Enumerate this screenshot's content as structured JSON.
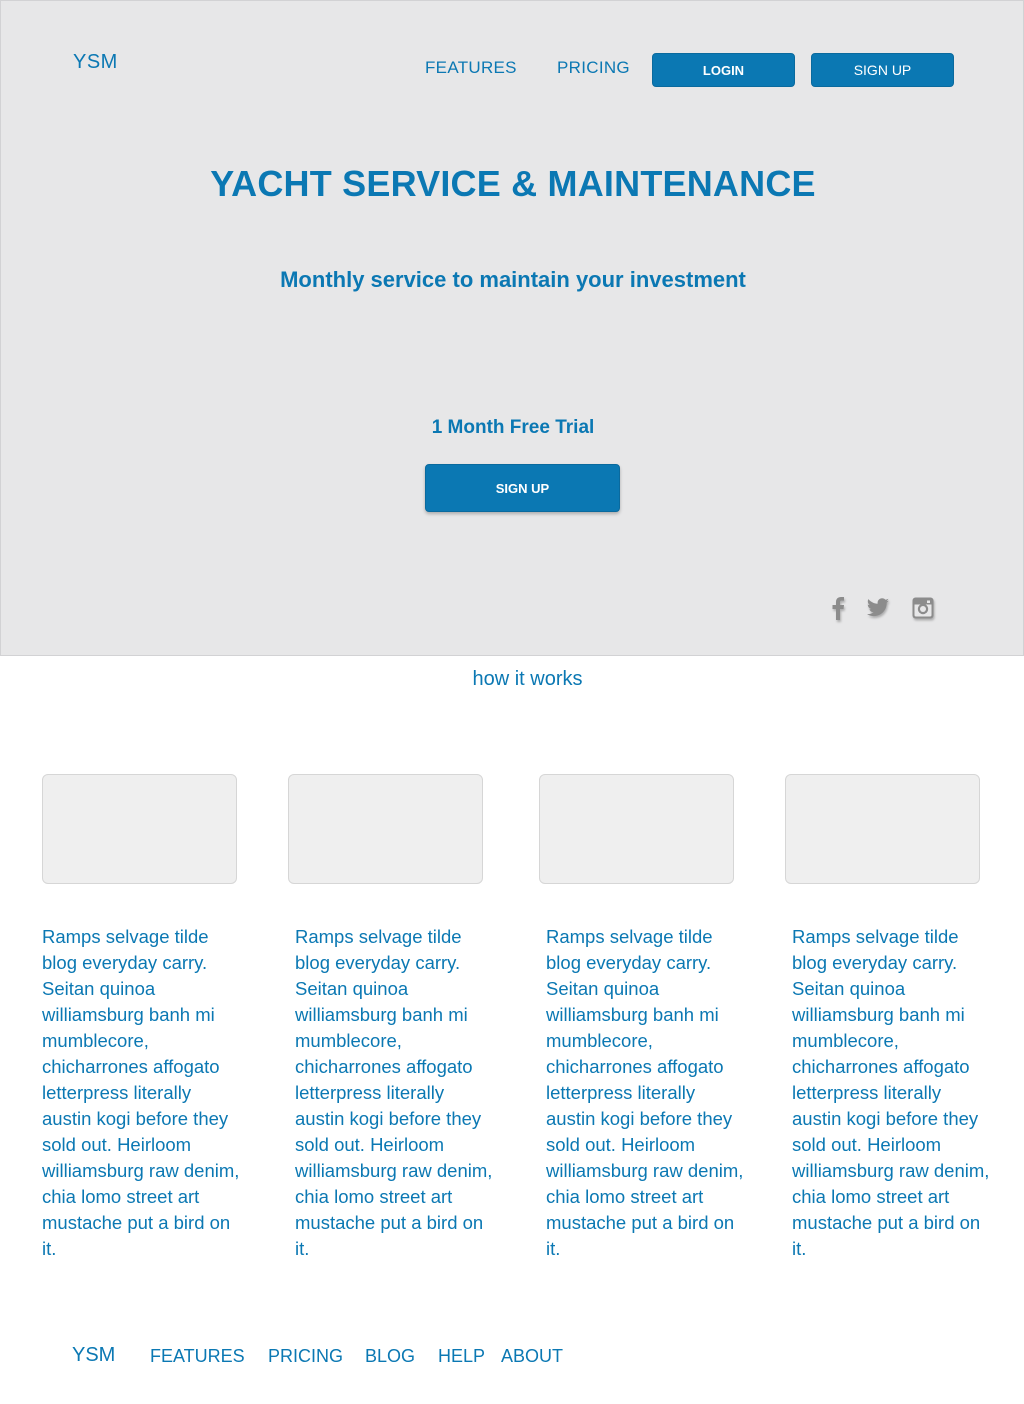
{
  "header": {
    "logo": "YSM",
    "nav": {
      "features": "FEATURES",
      "pricing": "PRICING",
      "login": "LOGIN",
      "signup": "SIGN UP"
    }
  },
  "hero": {
    "title": "YACHT SERVICE & MAINTENANCE",
    "subtitle": "Monthly service to maintain your investment",
    "trial": "1 Month Free Trial",
    "cta": "SIGN UP",
    "social_icons": [
      "facebook-icon",
      "twitter-icon",
      "instagram-icon"
    ]
  },
  "how_it_works": {
    "title": "how it works",
    "cards": [
      {
        "text": "Ramps selvage tilde blog everyday carry. Seitan quinoa williamsburg banh mi mumblecore, chicharrones affogato letterpress literally austin kogi before they sold out. Heirloom williamsburg raw denim, chia lomo street art mustache put a bird on it."
      },
      {
        "text": "Ramps selvage tilde blog everyday carry. Seitan quinoa williamsburg banh mi mumblecore, chicharrones affogato letterpress literally austin kogi before they sold out. Heirloom williamsburg raw denim, chia lomo street art mustache put a bird on it."
      },
      {
        "text": "Ramps selvage tilde blog everyday carry. Seitan quinoa williamsburg banh mi mumblecore, chicharrones affogato letterpress literally austin kogi before they sold out. Heirloom williamsburg raw denim, chia lomo street art mustache put a bird on it."
      },
      {
        "text": "Ramps selvage tilde blog everyday carry. Seitan quinoa williamsburg banh mi mumblecore, chicharrones affogato letterpress literally austin kogi before they sold out. Heirloom williamsburg raw denim, chia lomo street art mustache put a bird on it."
      }
    ]
  },
  "footer": {
    "logo": "YSM",
    "links": {
      "features": "FEATURES",
      "pricing": "PRICING",
      "blog": "BLOG",
      "help": "HELP",
      "about": "ABOUT"
    }
  },
  "colors": {
    "accent": "#0b78b3",
    "hero_bg": "#e7e7e8",
    "placeholder_bg": "#efefef",
    "icon_gray": "#8c8c8c"
  }
}
